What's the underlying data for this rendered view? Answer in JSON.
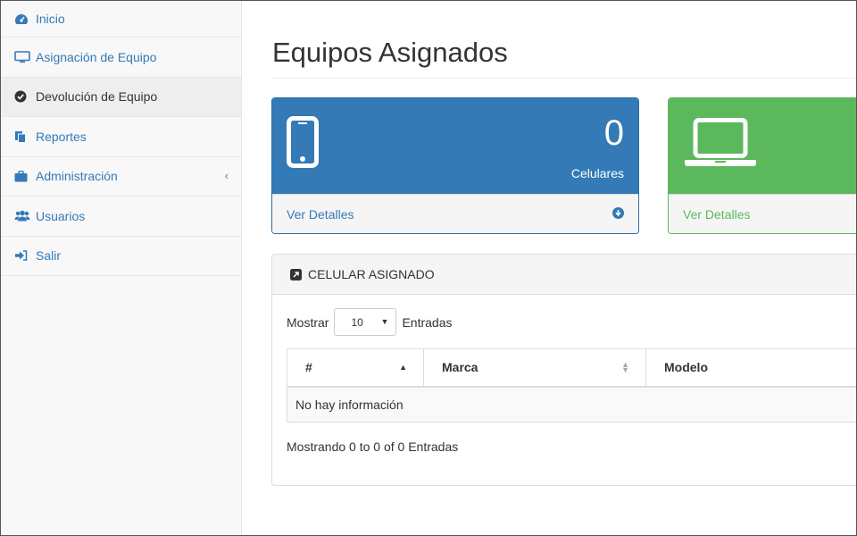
{
  "sidebar": {
    "items": [
      {
        "label": "Inicio",
        "icon": "dashboard-icon"
      },
      {
        "label": "Asignación de Equipo",
        "icon": "desktop-icon"
      },
      {
        "label": "Devolución de Equipo",
        "icon": "check-circle-icon"
      },
      {
        "label": "Reportes",
        "icon": "files-icon"
      },
      {
        "label": "Administración",
        "icon": "briefcase-icon",
        "chevron": "‹"
      },
      {
        "label": "Usuarios",
        "icon": "users-icon"
      },
      {
        "label": "Salir",
        "icon": "sign-out-icon"
      }
    ]
  },
  "main": {
    "title": "Equipos Asignados",
    "cards": [
      {
        "count": "0",
        "label": "Celulares",
        "footer": "Ver Detalles",
        "icon": "mobile-phone-icon",
        "color": "#337ab7"
      },
      {
        "footer": "Ver Detalles",
        "icon": "laptop-icon",
        "color": "#5cb85c"
      }
    ],
    "table_panel": {
      "heading": "CELULAR ASIGNADO",
      "length": {
        "prefix": "Mostrar",
        "value": "10",
        "suffix": "Entradas"
      },
      "columns": [
        "#",
        "Marca",
        "Modelo"
      ],
      "empty_text": "No hay información",
      "info": "Mostrando 0 to 0 of 0 Entradas"
    }
  },
  "colors": {
    "primary": "#337ab7",
    "success": "#5cb85c",
    "sidebar_bg": "#f8f8f8"
  }
}
